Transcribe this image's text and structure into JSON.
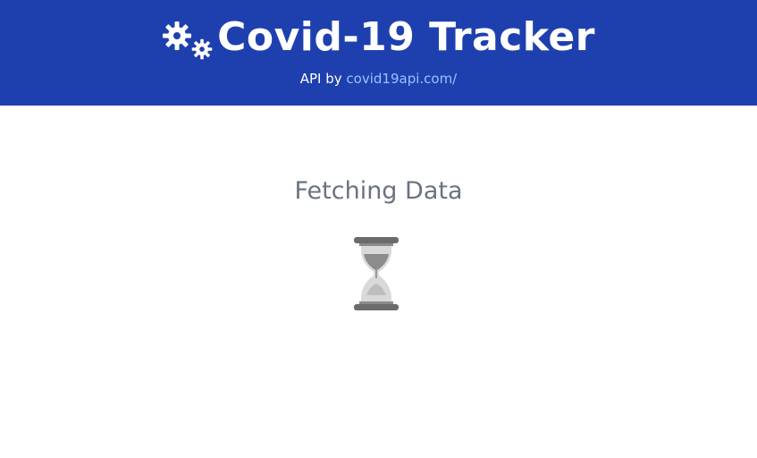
{
  "header": {
    "title": "Covid-19 Tracker",
    "api_prefix": "API by",
    "api_link": "covid19api.com/",
    "colors": {
      "background": "#1e40af",
      "text": "#ffffff",
      "link": "#93c5fd"
    },
    "icon": "gears-icon"
  },
  "main": {
    "status_text": "Fetching Data",
    "loading_icon": "hourglass-icon",
    "status_color": "#6b7280"
  }
}
